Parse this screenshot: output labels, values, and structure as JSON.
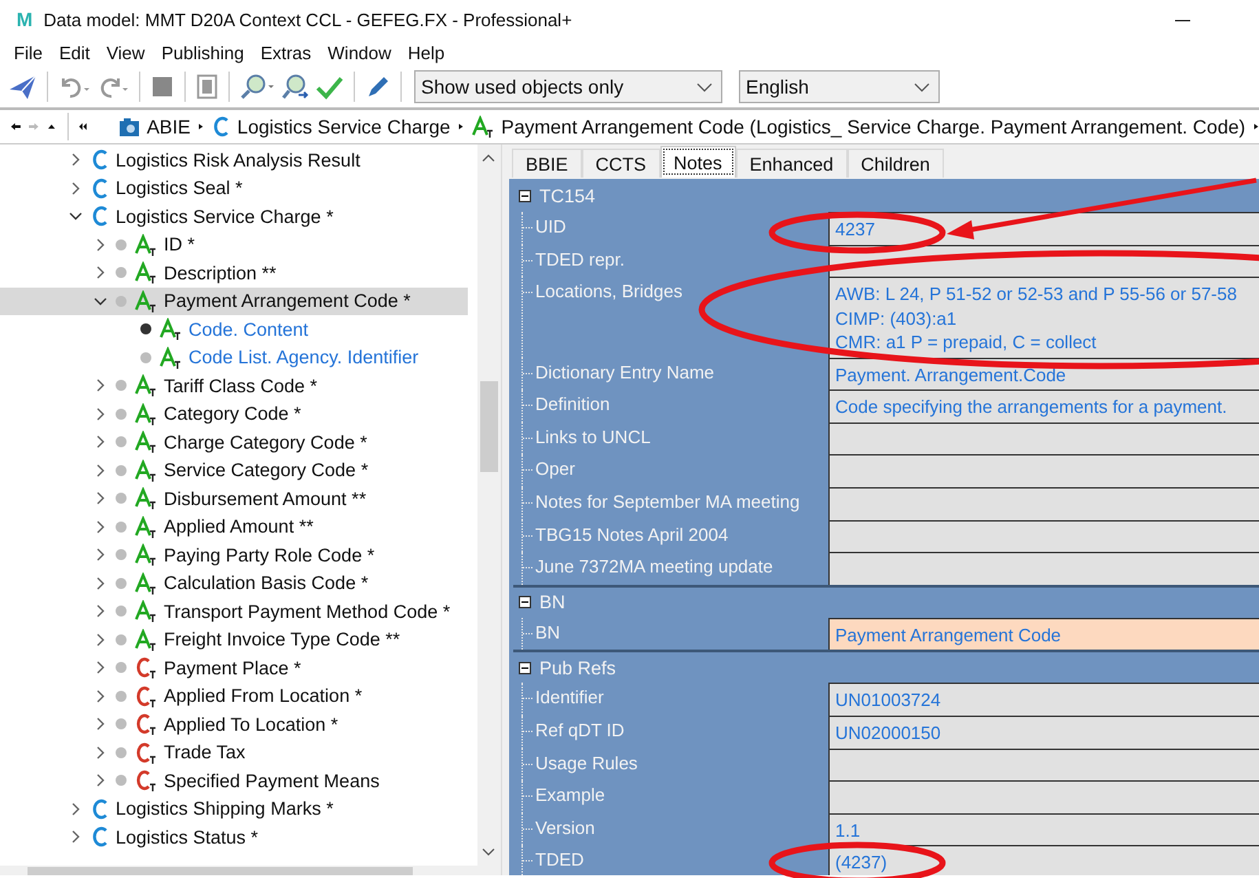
{
  "window": {
    "logo": "M",
    "title": "Data model: MMT D20A Context CCL - GEFEG.FX - Professional+"
  },
  "menu": [
    "File",
    "Edit",
    "View",
    "Publishing",
    "Extras",
    "Window",
    "Help"
  ],
  "toolbar": {
    "filter": {
      "value": "Show used objects only"
    },
    "language": {
      "value": "English"
    }
  },
  "breadcrumb": {
    "items": [
      {
        "kind": "abie",
        "label": "ABIE"
      },
      {
        "kind": "class",
        "label": "Logistics Service Charge"
      },
      {
        "kind": "attribute",
        "label": "Payment Arrangement Code (Logistics_ Service Charge. Payment Arrangement. Code)"
      }
    ]
  },
  "tree": {
    "items": [
      {
        "label": "Logistics Risk Analysis Result",
        "kind": "class",
        "leaf": false,
        "expanded": false,
        "selected": false
      },
      {
        "label": "Logistics Seal *",
        "kind": "class",
        "leaf": false,
        "expanded": false,
        "selected": false
      },
      {
        "label": "Logistics Service Charge *",
        "kind": "class",
        "leaf": false,
        "expanded": true,
        "selected": false,
        "children": [
          {
            "label": "ID *",
            "kind": "attribute",
            "leaf": false,
            "expanded": false,
            "selected": false,
            "active": false
          },
          {
            "label": "Description **",
            "kind": "attribute",
            "leaf": false,
            "expanded": false,
            "selected": false,
            "active": false
          },
          {
            "label": "Payment Arrangement Code *",
            "kind": "attribute",
            "leaf": false,
            "expanded": true,
            "selected": true,
            "active": false,
            "children": [
              {
                "label": "Code. Content",
                "kind": "component",
                "leaf": true,
                "selected": false,
                "active": true
              },
              {
                "label": "Code List. Agency. Identifier",
                "kind": "component",
                "leaf": true,
                "selected": false,
                "active": false
              }
            ]
          },
          {
            "label": "Tariff Class Code *",
            "kind": "attribute",
            "leaf": false,
            "expanded": false,
            "selected": false,
            "active": false
          },
          {
            "label": "Category Code *",
            "kind": "attribute",
            "leaf": false,
            "expanded": false,
            "selected": false,
            "active": false
          },
          {
            "label": "Charge Category Code *",
            "kind": "attribute",
            "leaf": false,
            "expanded": false,
            "selected": false,
            "active": false
          },
          {
            "label": "Service Category Code *",
            "kind": "attribute",
            "leaf": false,
            "expanded": false,
            "selected": false,
            "active": false
          },
          {
            "label": "Disbursement Amount **",
            "kind": "attribute",
            "leaf": false,
            "expanded": false,
            "selected": false,
            "active": false
          },
          {
            "label": "Applied Amount **",
            "kind": "attribute",
            "leaf": false,
            "expanded": false,
            "selected": false,
            "active": false
          },
          {
            "label": "Paying Party Role Code *",
            "kind": "attribute",
            "leaf": false,
            "expanded": false,
            "selected": false,
            "active": false
          },
          {
            "label": "Calculation Basis Code *",
            "kind": "attribute",
            "leaf": false,
            "expanded": false,
            "selected": false,
            "active": false
          },
          {
            "label": "Transport Payment Method Code *",
            "kind": "attribute",
            "leaf": false,
            "expanded": false,
            "selected": false,
            "active": false
          },
          {
            "label": "Freight Invoice Type Code **",
            "kind": "attribute",
            "leaf": false,
            "expanded": false,
            "selected": false,
            "active": false
          },
          {
            "label": "Payment Place *",
            "kind": "association",
            "leaf": false,
            "expanded": false,
            "selected": false,
            "active": false
          },
          {
            "label": "Applied From Location *",
            "kind": "association",
            "leaf": false,
            "expanded": false,
            "selected": false,
            "active": false
          },
          {
            "label": "Applied To Location *",
            "kind": "association",
            "leaf": false,
            "expanded": false,
            "selected": false,
            "active": false
          },
          {
            "label": "Trade Tax",
            "kind": "association",
            "leaf": false,
            "expanded": false,
            "selected": false,
            "active": false
          },
          {
            "label": "Specified Payment Means",
            "kind": "association",
            "leaf": false,
            "expanded": false,
            "selected": false,
            "active": false
          }
        ]
      },
      {
        "label": "Logistics Shipping Marks *",
        "kind": "class",
        "leaf": false,
        "expanded": false,
        "selected": false
      },
      {
        "label": "Logistics Status *",
        "kind": "class",
        "leaf": false,
        "expanded": false,
        "selected": false
      }
    ]
  },
  "tabs": [
    {
      "label": "BBIE",
      "selected": false
    },
    {
      "label": "CCTS",
      "selected": false
    },
    {
      "label": "Notes",
      "selected": true
    },
    {
      "label": "Enhanced",
      "selected": false
    },
    {
      "label": "Children",
      "selected": false
    }
  ],
  "grid": {
    "groups": [
      {
        "title": "TC154",
        "expanded": true,
        "rows": [
          {
            "label": "UID",
            "value": "4237",
            "highlighted": false
          },
          {
            "label": "TDED repr.",
            "value": "",
            "highlighted": false
          },
          {
            "label": "Locations, Bridges",
            "value": "AWB: L 24, P 51-52 or 52-53 and P 55-56 or 57-58\nCIMP: (403):a1\nCMR: a1  P = prepaid, C = collect",
            "highlighted": false
          },
          {
            "label": "Dictionary Entry Name",
            "value": "Payment. Arrangement.Code",
            "highlighted": false
          },
          {
            "label": "Definition",
            "value": "Code specifying the arrangements for a payment.",
            "highlighted": false
          },
          {
            "label": "Links to UNCL",
            "value": "",
            "highlighted": false
          },
          {
            "label": "Oper",
            "value": "",
            "highlighted": false
          },
          {
            "label": "Notes for September MA meeting",
            "value": "",
            "highlighted": false
          },
          {
            "label": "TBG15 Notes April 2004",
            "value": "",
            "highlighted": false
          },
          {
            "label": "June 7372MA meeting update",
            "value": "",
            "highlighted": false
          }
        ]
      },
      {
        "title": "BN",
        "expanded": true,
        "rows": [
          {
            "label": "BN",
            "value": "Payment Arrangement Code",
            "highlighted": true
          }
        ]
      },
      {
        "title": "Pub Refs",
        "expanded": true,
        "rows": [
          {
            "label": "Identifier",
            "value": "UN01003724",
            "highlighted": false
          },
          {
            "label": "Ref qDT ID",
            "value": "UN02000150",
            "highlighted": false
          },
          {
            "label": "Usage Rules",
            "value": "",
            "highlighted": false
          },
          {
            "label": "Example",
            "value": "",
            "highlighted": false
          },
          {
            "label": "Version",
            "value": "1.1",
            "highlighted": false
          },
          {
            "label": "TDED",
            "value": "(4237)",
            "highlighted": false
          }
        ]
      }
    ]
  }
}
